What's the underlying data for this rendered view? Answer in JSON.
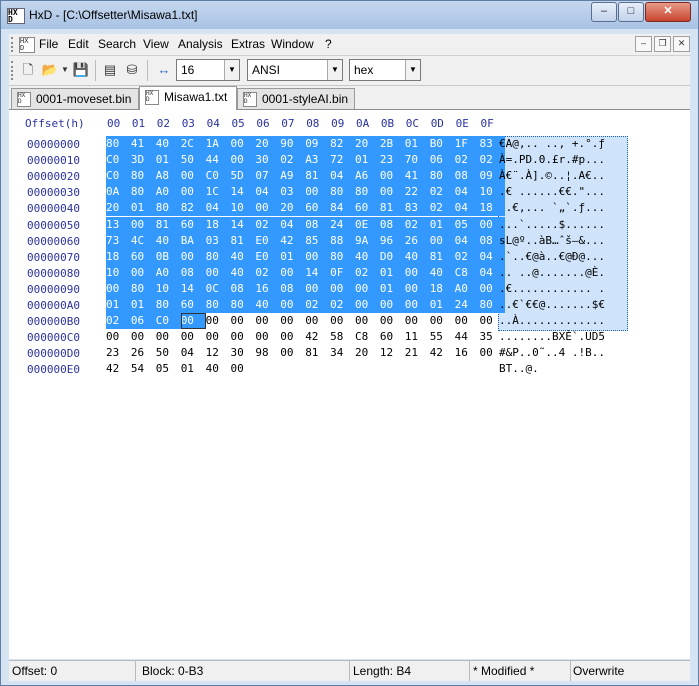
{
  "window": {
    "title": "HxD - [C:\\Offsetter\\Misawa1.txt]",
    "caption": {
      "minimize": "–",
      "maximize": "□",
      "close": "✕"
    }
  },
  "menu": {
    "items": [
      "File",
      "Edit",
      "Search",
      "View",
      "Analysis",
      "Extras",
      "Window",
      "?"
    ],
    "mdi": {
      "minimize": "–",
      "restore": "❐",
      "close": "✕"
    }
  },
  "toolbar": {
    "bytes_per_row": "16",
    "charset": "ANSI",
    "display_mode": "hex",
    "icons": [
      "new-file-icon",
      "open-folder-icon",
      "save-icon",
      "ram-icon",
      "disk-icon",
      "resize-arrows-icon"
    ]
  },
  "tabs": [
    {
      "label": "0001-moveset.bin",
      "active": false
    },
    {
      "label": "Misawa1.txt",
      "active": true
    },
    {
      "label": "0001-styleAI.bin",
      "active": false
    }
  ],
  "hex": {
    "offset_header": "Offset(h)",
    "columns": [
      "00",
      "01",
      "02",
      "03",
      "04",
      "05",
      "06",
      "07",
      "08",
      "09",
      "0A",
      "0B",
      "0C",
      "0D",
      "0E",
      "0F"
    ],
    "selection_end_count": 180,
    "rows": [
      {
        "offset": "00000000",
        "bytes": [
          "80",
          "41",
          "40",
          "2C",
          "1A",
          "00",
          "20",
          "90",
          "09",
          "82",
          "20",
          "2B",
          "01",
          "B0",
          "1F",
          "83"
        ],
        "ascii": "€A@,.. ..‚ +.°.ƒ"
      },
      {
        "offset": "00000010",
        "bytes": [
          "C0",
          "3D",
          "01",
          "50",
          "44",
          "00",
          "30",
          "02",
          "A3",
          "72",
          "01",
          "23",
          "70",
          "06",
          "02",
          "02"
        ],
        "ascii": "À=.PD.0.£r.#p..."
      },
      {
        "offset": "00000020",
        "bytes": [
          "C0",
          "80",
          "A8",
          "00",
          "C0",
          "5D",
          "07",
          "A9",
          "81",
          "04",
          "A6",
          "00",
          "41",
          "80",
          "08",
          "09"
        ],
        "ascii": "À€¨.À].©..¦.A€.."
      },
      {
        "offset": "00000030",
        "bytes": [
          "0A",
          "80",
          "A0",
          "00",
          "1C",
          "14",
          "04",
          "03",
          "00",
          "80",
          "80",
          "00",
          "22",
          "02",
          "04",
          "10"
        ],
        "ascii": ".€ ......€€.\"..."
      },
      {
        "offset": "00000040",
        "bytes": [
          "20",
          "01",
          "80",
          "82",
          "04",
          "10",
          "00",
          "20",
          "60",
          "84",
          "60",
          "81",
          "83",
          "02",
          "04",
          "18"
        ],
        "ascii": " .€‚... `„`.ƒ..."
      },
      {
        "offset": "00000050",
        "bytes": [
          "13",
          "00",
          "81",
          "60",
          "18",
          "14",
          "02",
          "04",
          "08",
          "24",
          "0E",
          "08",
          "02",
          "01",
          "05",
          "00"
        ],
        "ascii": "...`.....$......"
      },
      {
        "offset": "00000060",
        "bytes": [
          "73",
          "4C",
          "40",
          "BA",
          "03",
          "81",
          "E0",
          "42",
          "85",
          "88",
          "9A",
          "96",
          "26",
          "00",
          "04",
          "08"
        ],
        "ascii": "sL@º..àB…ˆš–&..."
      },
      {
        "offset": "00000070",
        "bytes": [
          "18",
          "60",
          "0B",
          "00",
          "80",
          "40",
          "E0",
          "01",
          "00",
          "80",
          "40",
          "D0",
          "40",
          "81",
          "02",
          "04"
        ],
        "ascii": ".`..€@à..€@Ð@..."
      },
      {
        "offset": "00000080",
        "bytes": [
          "10",
          "00",
          "A0",
          "08",
          "00",
          "40",
          "02",
          "00",
          "14",
          "0F",
          "02",
          "01",
          "00",
          "40",
          "C8",
          "04"
        ],
        "ascii": ".. ..@.......@È."
      },
      {
        "offset": "00000090",
        "bytes": [
          "00",
          "80",
          "10",
          "14",
          "0C",
          "08",
          "16",
          "08",
          "00",
          "00",
          "00",
          "01",
          "00",
          "18",
          "A0",
          "00"
        ],
        "ascii": ".€............ ."
      },
      {
        "offset": "000000A0",
        "bytes": [
          "01",
          "01",
          "80",
          "60",
          "80",
          "80",
          "40",
          "00",
          "02",
          "02",
          "00",
          "00",
          "00",
          "01",
          "24",
          "80"
        ],
        "ascii": "..€`€€@.......$€"
      },
      {
        "offset": "000000B0",
        "bytes": [
          "02",
          "06",
          "C0",
          "00",
          "00",
          "00",
          "00",
          "00",
          "00",
          "00",
          "00",
          "00",
          "00",
          "00",
          "00",
          "00"
        ],
        "ascii": "..À............."
      },
      {
        "offset": "000000C0",
        "bytes": [
          "00",
          "00",
          "00",
          "00",
          "00",
          "00",
          "00",
          "00",
          "42",
          "58",
          "C8",
          "60",
          "11",
          "55",
          "44",
          "35"
        ],
        "ascii": "........BXÈ`.UD5"
      },
      {
        "offset": "000000D0",
        "bytes": [
          "23",
          "26",
          "50",
          "04",
          "12",
          "30",
          "98",
          "00",
          "81",
          "34",
          "20",
          "12",
          "21",
          "42",
          "16",
          "00"
        ],
        "ascii": "#&P..0˜..4 .!B.."
      },
      {
        "offset": "000000E0",
        "bytes": [
          "42",
          "54",
          "05",
          "01",
          "40",
          "00"
        ],
        "ascii": "BT..@."
      }
    ]
  },
  "status": {
    "offset": "Offset: 0",
    "block": "Block: 0-B3",
    "length": "Length: B4",
    "modified": "* Modified *",
    "mode": "Overwrite"
  }
}
